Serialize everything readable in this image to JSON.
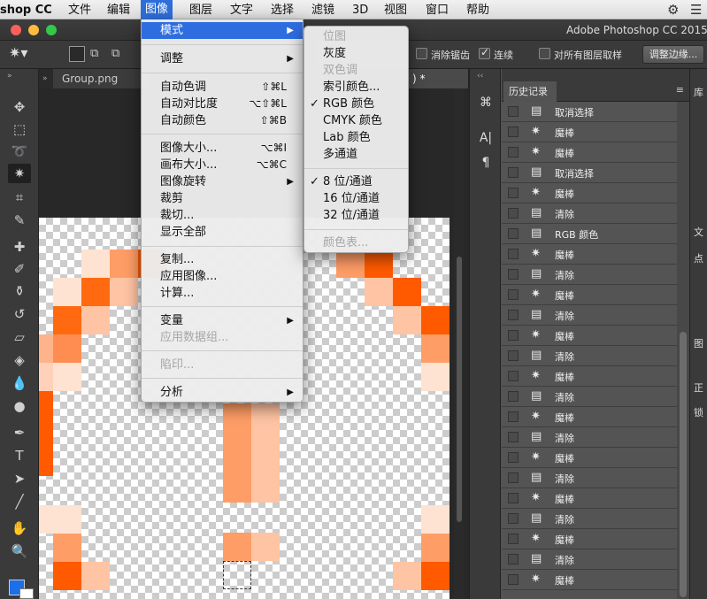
{
  "menubar": {
    "app_name": "shop CC",
    "items": [
      "文件",
      "编辑",
      "图像",
      "图层",
      "文字",
      "选择",
      "滤镜",
      "3D",
      "视图",
      "窗口",
      "帮助"
    ],
    "active": "图像",
    "tray_icons": [
      "gear-icon",
      "list-icon"
    ]
  },
  "window": {
    "title": "Adobe Photoshop CC 2015"
  },
  "options_bar": {
    "anti_alias_label": "消除锯齿",
    "contiguous_label": "连续",
    "sample_all_label": "对所有图层取样",
    "refine_edge_label": "调整边缘...",
    "anti_alias_checked": false,
    "contiguous_checked": true,
    "sample_all_checked": false
  },
  "document": {
    "tabs": [
      "Group.png",
      ") *"
    ],
    "accent_color": "#ff6a1a"
  },
  "image_menu": {
    "items": [
      {
        "label": "模式",
        "submenu": true,
        "highlight": true
      },
      {
        "label": "调整",
        "submenu": true
      },
      {
        "label": "自动色调",
        "shortcut": "⇧⌘L"
      },
      {
        "label": "自动对比度",
        "shortcut": "⌥⇧⌘L"
      },
      {
        "label": "自动颜色",
        "shortcut": "⇧⌘B"
      },
      {
        "label": "图像大小...",
        "shortcut": "⌥⌘I"
      },
      {
        "label": "画布大小...",
        "shortcut": "⌥⌘C"
      },
      {
        "label": "图像旋转",
        "submenu": true
      },
      {
        "label": "裁剪"
      },
      {
        "label": "裁切..."
      },
      {
        "label": "显示全部"
      },
      {
        "label": "复制..."
      },
      {
        "label": "应用图像..."
      },
      {
        "label": "计算..."
      },
      {
        "label": "变量",
        "submenu": true
      },
      {
        "label": "应用数据组...",
        "disabled": true
      },
      {
        "label": "陷印...",
        "disabled": true
      },
      {
        "label": "分析",
        "submenu": true
      }
    ]
  },
  "mode_menu": {
    "items": [
      {
        "label": "位图",
        "disabled": true
      },
      {
        "label": "灰度"
      },
      {
        "label": "双色调",
        "disabled": true
      },
      {
        "label": "索引颜色..."
      },
      {
        "label": "RGB 颜色",
        "checked": true
      },
      {
        "label": "CMYK 颜色"
      },
      {
        "label": "Lab 颜色"
      },
      {
        "label": "多通道"
      },
      {
        "label": "8 位/通道",
        "checked": true
      },
      {
        "label": "16 位/通道"
      },
      {
        "label": "32 位/通道"
      },
      {
        "label": "颜色表...",
        "disabled": true
      }
    ]
  },
  "history": {
    "tab_label": "历史记录",
    "items": [
      {
        "icon": "document-icon",
        "label": "取消选择"
      },
      {
        "icon": "magic-wand-icon",
        "label": "魔棒"
      },
      {
        "icon": "magic-wand-icon",
        "label": "魔棒"
      },
      {
        "icon": "document-icon",
        "label": "取消选择"
      },
      {
        "icon": "magic-wand-icon",
        "label": "魔棒"
      },
      {
        "icon": "document-icon",
        "label": "清除"
      },
      {
        "icon": "document-icon",
        "label": "RGB 颜色"
      },
      {
        "icon": "magic-wand-icon",
        "label": "魔棒"
      },
      {
        "icon": "document-icon",
        "label": "清除"
      },
      {
        "icon": "magic-wand-icon",
        "label": "魔棒"
      },
      {
        "icon": "document-icon",
        "label": "清除"
      },
      {
        "icon": "magic-wand-icon",
        "label": "魔棒"
      },
      {
        "icon": "document-icon",
        "label": "清除"
      },
      {
        "icon": "magic-wand-icon",
        "label": "魔棒"
      },
      {
        "icon": "document-icon",
        "label": "清除"
      },
      {
        "icon": "magic-wand-icon",
        "label": "魔棒"
      },
      {
        "icon": "document-icon",
        "label": "清除"
      },
      {
        "icon": "magic-wand-icon",
        "label": "魔棒"
      },
      {
        "icon": "document-icon",
        "label": "清除"
      },
      {
        "icon": "magic-wand-icon",
        "label": "魔棒"
      },
      {
        "icon": "document-icon",
        "label": "清除"
      },
      {
        "icon": "magic-wand-icon",
        "label": "魔棒"
      },
      {
        "icon": "document-icon",
        "label": "清除"
      },
      {
        "icon": "magic-wand-icon",
        "label": "魔棒"
      }
    ]
  },
  "right_panel": {
    "labels": [
      "库",
      "文",
      "点",
      "图",
      "正",
      "锁"
    ]
  }
}
